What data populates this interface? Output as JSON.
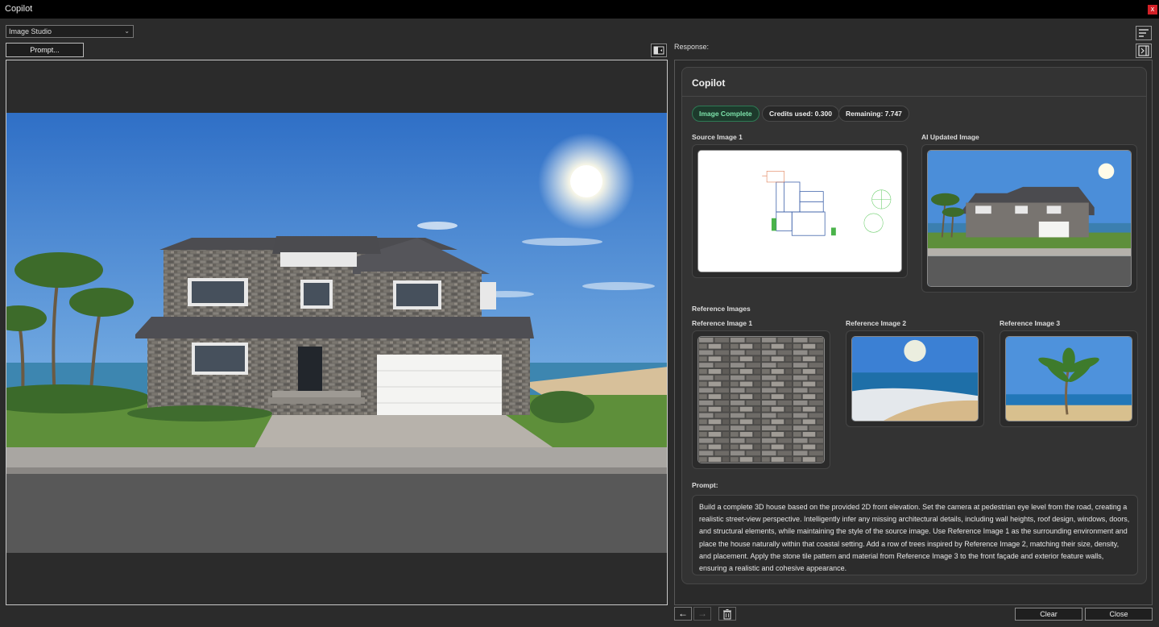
{
  "window": {
    "title": "Copilot",
    "close_label": "x"
  },
  "toolbar": {
    "studio_select": "Image Studio",
    "prompt_button": "Prompt..."
  },
  "response": {
    "label": "Response:",
    "card_title": "Copilot",
    "badges": {
      "status": "Image Complete",
      "credits_used": "Credits used: 0.300",
      "remaining": "Remaining: 7.747"
    },
    "source_label": "Source Image 1",
    "ai_label": "AI Updated Image",
    "reference_heading": "Reference Images",
    "references": [
      "Reference Image 1",
      "Reference Image 2",
      "Reference Image 3"
    ],
    "prompt_heading": "Prompt:",
    "prompt_text": "Build a complete 3D house based on the provided 2D front elevation. Set the camera at pedestrian eye level from the road, creating a realistic street-view perspective. Intelligently infer any missing architectural details, including wall heights, roof design, windows, doors, and structural elements, while maintaining the style of the source image. Use Reference Image 1 as the surrounding environment and place the house naturally within that coastal setting. Add a row of trees inspired by Reference Image 2, matching their size, density, and placement. Apply the stone tile pattern and material from Reference Image 3 to the front façade and exterior feature walls, ensuring a realistic and cohesive appearance."
  },
  "footer": {
    "back_icon": "←",
    "forward_icon": "→",
    "clear_button": "Clear",
    "close_button": "Close"
  },
  "colors": {
    "accent_green": "#7de3ab",
    "close_red": "#d32027",
    "sky": "#3f86d6"
  }
}
